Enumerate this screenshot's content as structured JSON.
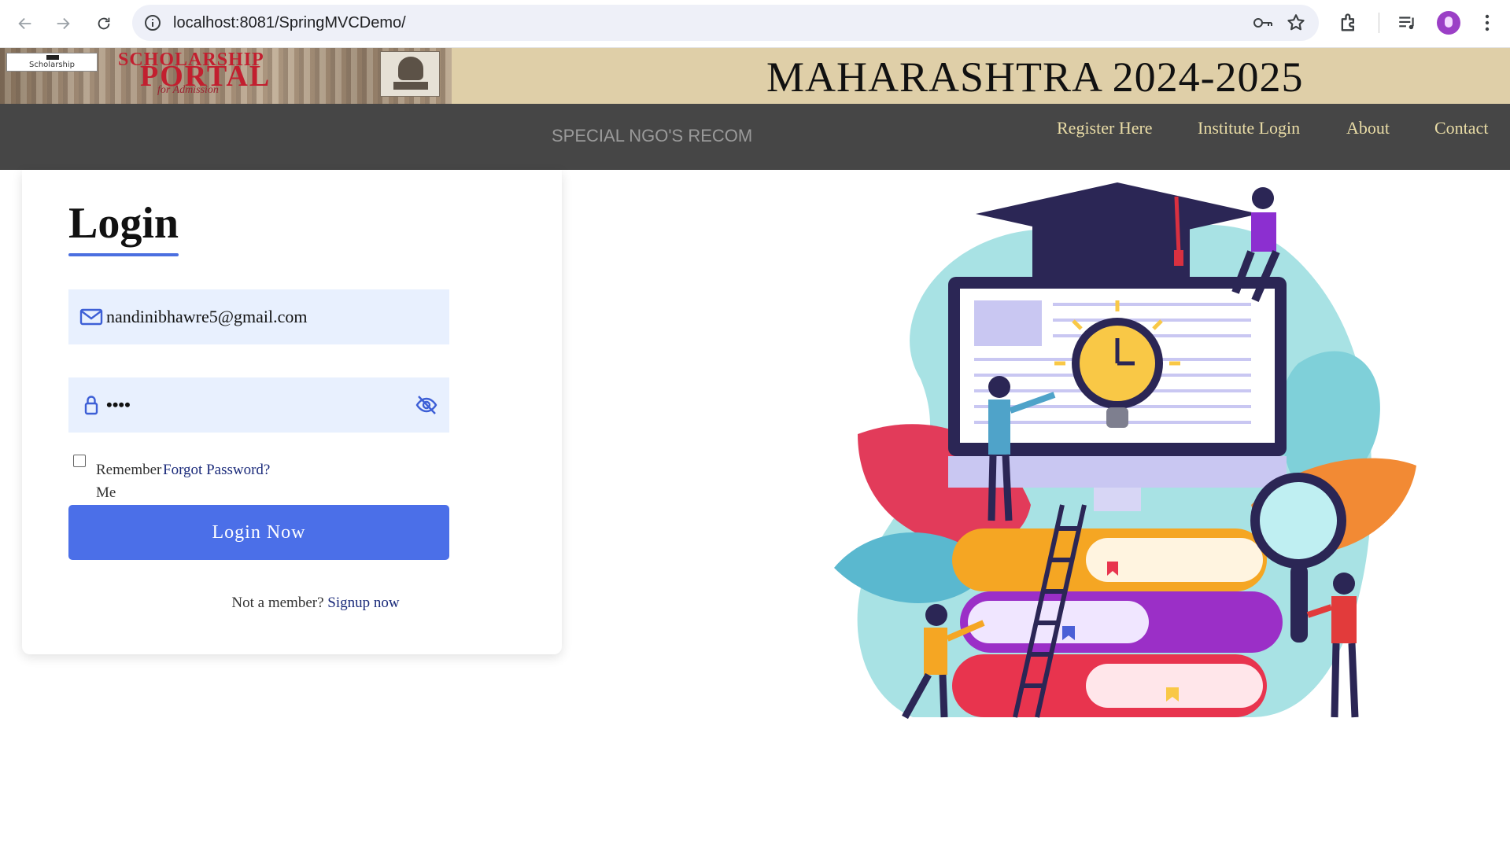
{
  "browser": {
    "url": "localhost:8081/SpringMVCDemo/"
  },
  "banner": {
    "logo_box_text": "Scholarship",
    "portal_line1": "SCHOLARSHIP",
    "portal_line2": "PORTAL",
    "portal_subtitle": "for Admission",
    "title": "MAHARASHTRA 2024-2025"
  },
  "nav": {
    "marquee": "SPECIAL NGO'S RECOM",
    "links": [
      "Register Here",
      "Institute Login",
      "About",
      "Contact"
    ],
    "link_color": "#e9dca6",
    "bar_color": "#464646"
  },
  "login": {
    "title": "Login",
    "email_value": "nandinibhawre5@gmail.com",
    "password_value": "••••",
    "remember_label": "Remember Me",
    "forgot_label": "Forgot Password?",
    "button_label": "Login Now",
    "signup_prompt": "Not a member?",
    "signup_link": "Signup now",
    "accent_color": "#4b6fe8"
  },
  "icons": {
    "email": "mail-icon",
    "password": "lock-icon",
    "toggle": "eye-off-icon"
  }
}
